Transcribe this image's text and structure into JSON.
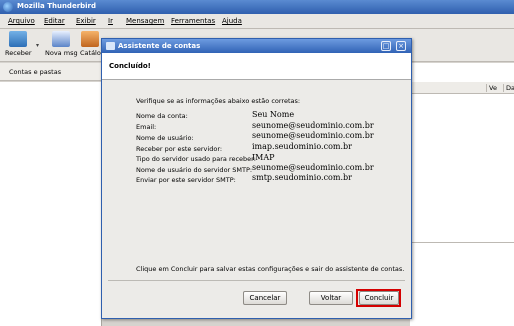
{
  "window": {
    "title": "Mozilla Thunderbird"
  },
  "menu": [
    "Arquivo",
    "Editar",
    "Exibir",
    "Ir",
    "Mensagem",
    "Ferramentas",
    "Ajuda"
  ],
  "toolbar": {
    "get": "Receber",
    "new": "Nova msg",
    "book": "Catálo"
  },
  "left_pane": {
    "header": "Contas e pastas"
  },
  "columns": [
    "Ve",
    "Da"
  ],
  "dialog": {
    "title": "Assistente de contas",
    "header": "Concluído!",
    "intro": "Verifique se as informações abaixo estão corretas:",
    "rows": [
      {
        "label": "Nome da conta:",
        "value": "Seu Nome"
      },
      {
        "label": "Email:",
        "value": "seunome@seudominio.com.br"
      },
      {
        "label": "Nome de usuário:",
        "value": "seunome@seudominio.com.br"
      },
      {
        "label": "Receber por este servidor:",
        "value": "imap.seudominio.com.br"
      },
      {
        "label": "Tipo do servidor usado para receber:",
        "value": "IMAP"
      },
      {
        "label": "Nome de usuário do servidor SMTP:",
        "value": "seunome@seudominio.com.br"
      },
      {
        "label": "Enviar por este servidor SMTP:",
        "value": "smtp.seudominio.com.br"
      }
    ],
    "footer": "Clique em Concluir para salvar estas configurações e sair do assistente de contas.",
    "buttons": {
      "cancel": "Cancelar",
      "back": "Voltar",
      "finish": "Concluir"
    }
  },
  "colors": {
    "title_bar": "#3163b5",
    "highlight": "#d40000"
  }
}
